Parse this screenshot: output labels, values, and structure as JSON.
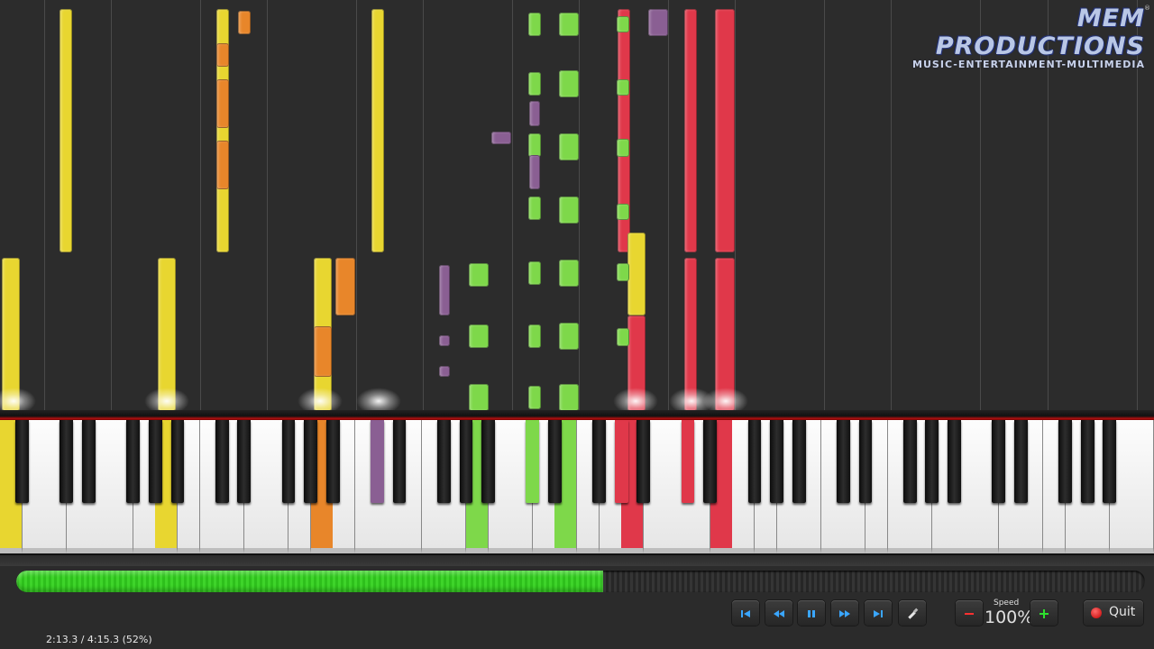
{
  "logo": {
    "main": "MEM PRODUCTIONS",
    "sub": "MUSIC-ENTERTAINMENT-MULTIMEDIA",
    "mark": "®"
  },
  "playback": {
    "timecode": "2:13.3 / 4:15.3 (52%)",
    "progress_fraction": 0.52
  },
  "controls": {
    "speed_label": "Speed",
    "speed_value": "100%",
    "quit_label": "Quit",
    "icons": [
      "skip-to-start-icon",
      "rewind-icon",
      "pause-icon",
      "fast-forward-icon",
      "skip-to-end-icon",
      "settings-icon",
      "minus-icon",
      "plus-icon",
      "quit-icon"
    ]
  },
  "colors": {
    "yellow": "#e8d630",
    "orange": "#e8862a",
    "purple": "#8a5f93",
    "green": "#7ed84a",
    "red": "#e0384a",
    "progress": "#3ed42a",
    "button_icon": "#3aa6ff"
  }
}
